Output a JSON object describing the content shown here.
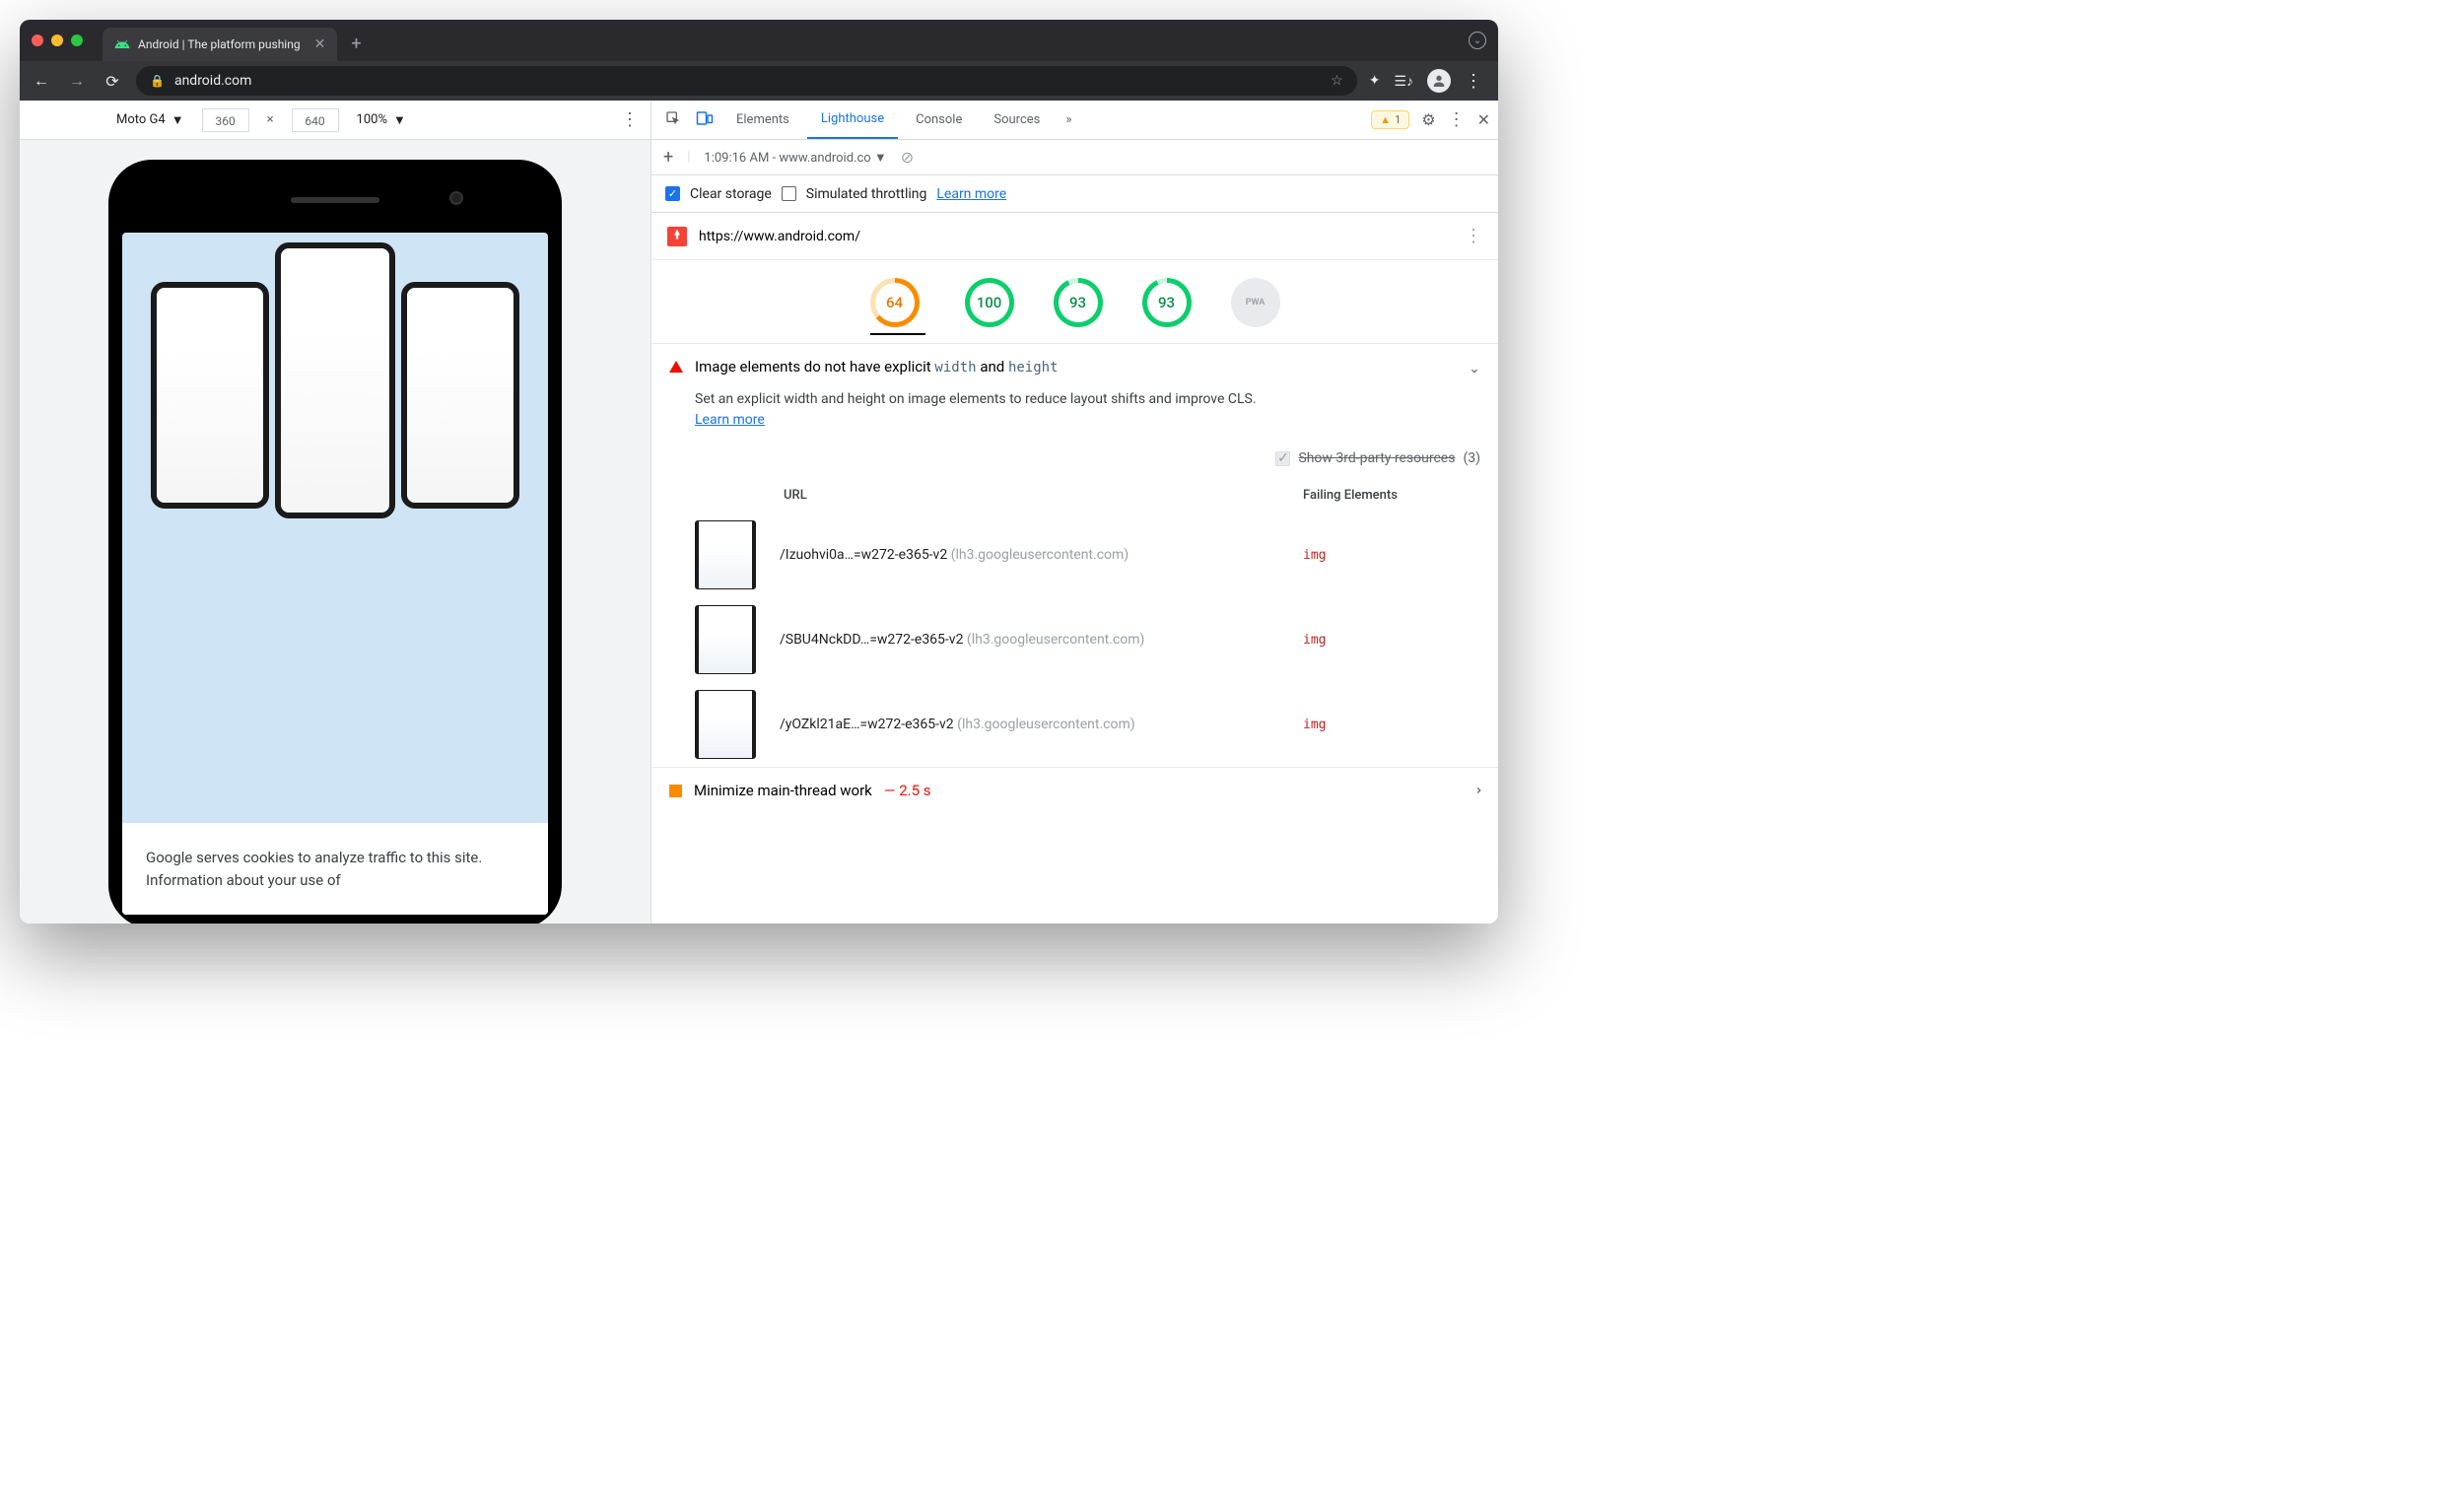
{
  "browser": {
    "tab_title": "Android | The platform pushing",
    "url": "android.com"
  },
  "device_toolbar": {
    "device": "Moto G4",
    "width": "360",
    "height": "640",
    "zoom": "100%"
  },
  "viewport": {
    "cookie_banner": "Google serves cookies to analyze traffic to this site. Information about your use of"
  },
  "devtools": {
    "tabs": [
      "Elements",
      "Lighthouse",
      "Console",
      "Sources"
    ],
    "active_tab": "Lighthouse",
    "warning_count": "1",
    "report_time": "1:09:16 AM - www.android.co",
    "clear_storage": "Clear storage",
    "simulated_throttling": "Simulated throttling",
    "learn_more": "Learn more",
    "audited_url": "https://www.android.com/"
  },
  "scores": {
    "performance": "64",
    "accessibility": "100",
    "best_practices": "93",
    "seo": "93",
    "pwa": "PWA"
  },
  "audit": {
    "title_a": "Image elements do not have explicit",
    "title_w": "width",
    "title_and": "and",
    "title_h": "height",
    "description": "Set an explicit width and height on image elements to reduce layout shifts and improve CLS.",
    "learn_more": "Learn more",
    "third_party_label": "Show 3rd-party resources",
    "third_party_count": "(3)",
    "col_url": "URL",
    "col_fail": "Failing Elements",
    "rows": [
      {
        "path": "/Izuohvi0a…=w272-e365-v2",
        "domain": "(lh3.googleusercontent.com)",
        "tag": "img"
      },
      {
        "path": "/SBU4NckDD…=w272-e365-v2",
        "domain": "(lh3.googleusercontent.com)",
        "tag": "img"
      },
      {
        "path": "/yOZkl21aE…=w272-e365-v2",
        "domain": "(lh3.googleusercontent.com)",
        "tag": "img"
      }
    ]
  },
  "audit2": {
    "title": "Minimize main-thread work",
    "value": "— 2.5 s"
  }
}
